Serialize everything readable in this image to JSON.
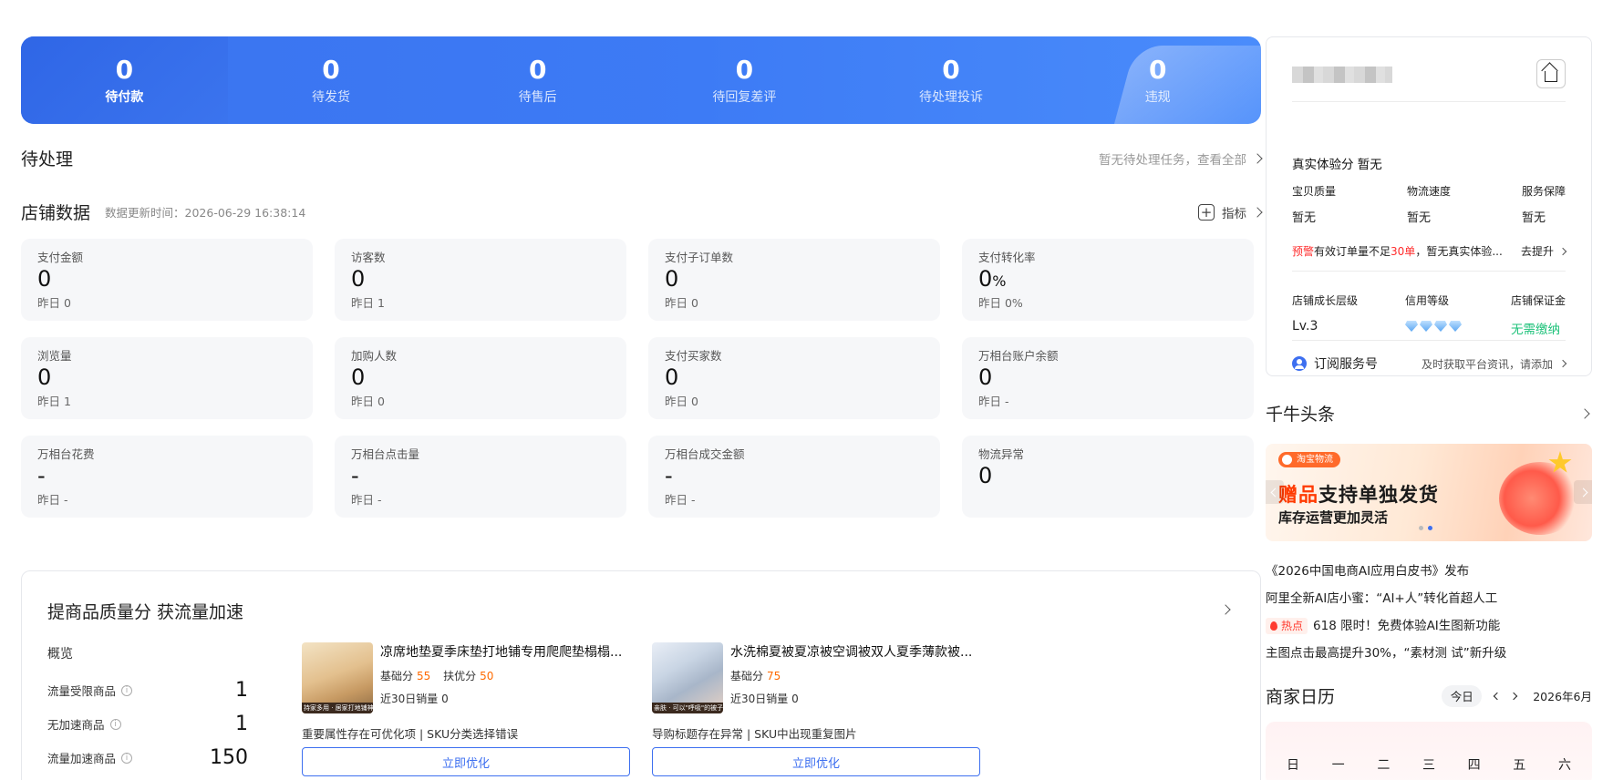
{
  "status_bar": [
    {
      "count": "0",
      "label": "待付款"
    },
    {
      "count": "0",
      "label": "待发货"
    },
    {
      "count": "0",
      "label": "待售后"
    },
    {
      "count": "0",
      "label": "待回复差评"
    },
    {
      "count": "0",
      "label": "待处理投诉"
    },
    {
      "count": "0",
      "label": "违规"
    }
  ],
  "pending": {
    "title": "待处理",
    "right_text": "暂无待处理任务，查看全部"
  },
  "shop_data": {
    "title": "店铺数据",
    "updated": "数据更新时间：2026-06-29 16:38:14",
    "indicator_label": "指标",
    "cards": [
      {
        "label": "支付金额",
        "value": "0",
        "unit": "",
        "yesterday": "昨日 0"
      },
      {
        "label": "访客数",
        "value": "0",
        "unit": "",
        "yesterday": "昨日 1"
      },
      {
        "label": "支付子订单数",
        "value": "0",
        "unit": "",
        "yesterday": "昨日 0"
      },
      {
        "label": "支付转化率",
        "value": "0",
        "unit": "%",
        "yesterday": "昨日 0%"
      },
      {
        "label": "浏览量",
        "value": "0",
        "unit": "",
        "yesterday": "昨日 1"
      },
      {
        "label": "加购人数",
        "value": "0",
        "unit": "",
        "yesterday": "昨日 0"
      },
      {
        "label": "支付买家数",
        "value": "0",
        "unit": "",
        "yesterday": "昨日 0"
      },
      {
        "label": "万相台账户余额",
        "value": "0",
        "unit": "",
        "yesterday": "昨日 -"
      },
      {
        "label": "万相台花费",
        "value": "-",
        "unit": "",
        "yesterday": "昨日 -"
      },
      {
        "label": "万相台点击量",
        "value": "-",
        "unit": "",
        "yesterday": "昨日 -"
      },
      {
        "label": "万相台成交金额",
        "value": "-",
        "unit": "",
        "yesterday": "昨日 -"
      },
      {
        "label": "物流异常",
        "value": "0",
        "unit": "",
        "yesterday": ""
      }
    ]
  },
  "quality": {
    "title": "提商品质量分 获流量加速",
    "overview_title": "概览",
    "overview": [
      {
        "label": "流量受限商品",
        "value": "1"
      },
      {
        "label": "无加速商品",
        "value": "1"
      },
      {
        "label": "流量加速商品",
        "value": "150"
      }
    ],
    "products": [
      {
        "name": "凉席地垫夏季床垫打地铺专用爬爬垫榻榻...",
        "score_label": "基础分",
        "score": "55",
        "score2_label": "扶优分",
        "score2": "50",
        "sales": "近30日销量 0",
        "issues": "重要属性存在可优化项 | SKU分类选择错误",
        "button": "立即优化",
        "thumb_tag": "持家多用 · 居家打地铺神器"
      },
      {
        "name": "水洗棉夏被夏凉被空调被双人夏季薄款被...",
        "score_label": "基础分",
        "score": "75",
        "sales": "近30日销量 0",
        "issues": "导购标题存在异常 | SKU中出现重复图片",
        "button": "立即优化",
        "thumb_tag": "亲肤 · 可以\"呼吸\"的被子"
      }
    ]
  },
  "shop_card": {
    "experience": "真实体验分  暂无",
    "metrics": [
      {
        "label": "宝贝质量",
        "value": "暂无"
      },
      {
        "label": "物流速度",
        "value": "暂无"
      },
      {
        "label": "服务保障",
        "value": "暂无"
      }
    ],
    "warn_tag": "预警",
    "warn_text_1": "有效订单量不足",
    "warn_highlight": "30单",
    "warn_text_2": "，暂无真实体验...",
    "warn_action": "去提升",
    "growth": [
      {
        "label": "店铺成长层级",
        "value": "Lv.3"
      },
      {
        "label": "信用等级",
        "value": ""
      },
      {
        "label": "店铺保证金",
        "value": "无需缴纳"
      }
    ],
    "credit_gems": 4,
    "subscribe_label": "订阅服务号",
    "subscribe_hint": "及时获取平台资讯，请添加"
  },
  "news": {
    "title": "千牛头条",
    "banner": {
      "brand": "淘宝物流",
      "headline_highlight": "赠品",
      "headline_rest": "支持单独发货",
      "subline": "库存运营更加灵活"
    },
    "items": [
      {
        "text": "《2026中国电商AI应用白皮书》发布",
        "hot": ""
      },
      {
        "text": "阿里全新AI店小蜜：“AI+人”转化首超人工",
        "hot": ""
      },
      {
        "text": "618 限时！免费体验AI生图新功能",
        "hot": "热点"
      },
      {
        "text": "主图点击最高提升30%，“素材测 试”新升级",
        "hot": ""
      }
    ]
  },
  "calendar": {
    "title": "商家日历",
    "today": "今日",
    "month": "2026年6月",
    "weekdays": [
      "日",
      "一",
      "二",
      "三",
      "四",
      "五",
      "六"
    ]
  },
  "colors": {
    "primary": "#3d6ff0",
    "accent_orange": "#ff6a00",
    "warn_red": "#ff2d2d",
    "ok_green": "#1ec27a"
  }
}
